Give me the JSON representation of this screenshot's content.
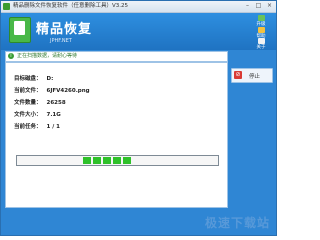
{
  "window": {
    "title": "精品删除文件恢复软件（任意删除工具）V3.25",
    "controls": [
      "–",
      "□",
      "×"
    ]
  },
  "header": {
    "logo_title": "精品恢复",
    "logo_subtitle": "JPHF.NET",
    "buttons": [
      {
        "label": "升级",
        "icon": "upgrade-icon",
        "color": "#6ac25a"
      },
      {
        "label": "帮助",
        "icon": "help-icon",
        "color": "#f4c23f"
      },
      {
        "label": "关于",
        "icon": "about-icon",
        "color": "#f2f2f2"
      }
    ]
  },
  "status": {
    "text": "正在扫描数据，请耐心等待"
  },
  "info": [
    {
      "label": "目标磁盘：",
      "value": "D:"
    },
    {
      "label": "当前文件：",
      "value": "6JFV4260.png"
    },
    {
      "label": "文件数量：",
      "value": "26258"
    },
    {
      "label": "文件大小：",
      "value": "7.1G"
    },
    {
      "label": "当前任务：",
      "value": "1 / 1"
    }
  ],
  "progress": {
    "blocks_shown": 5,
    "color": "#2fc12a"
  },
  "actions": {
    "stop_label": "停止"
  },
  "watermark": {
    "text": "极速下载站"
  }
}
